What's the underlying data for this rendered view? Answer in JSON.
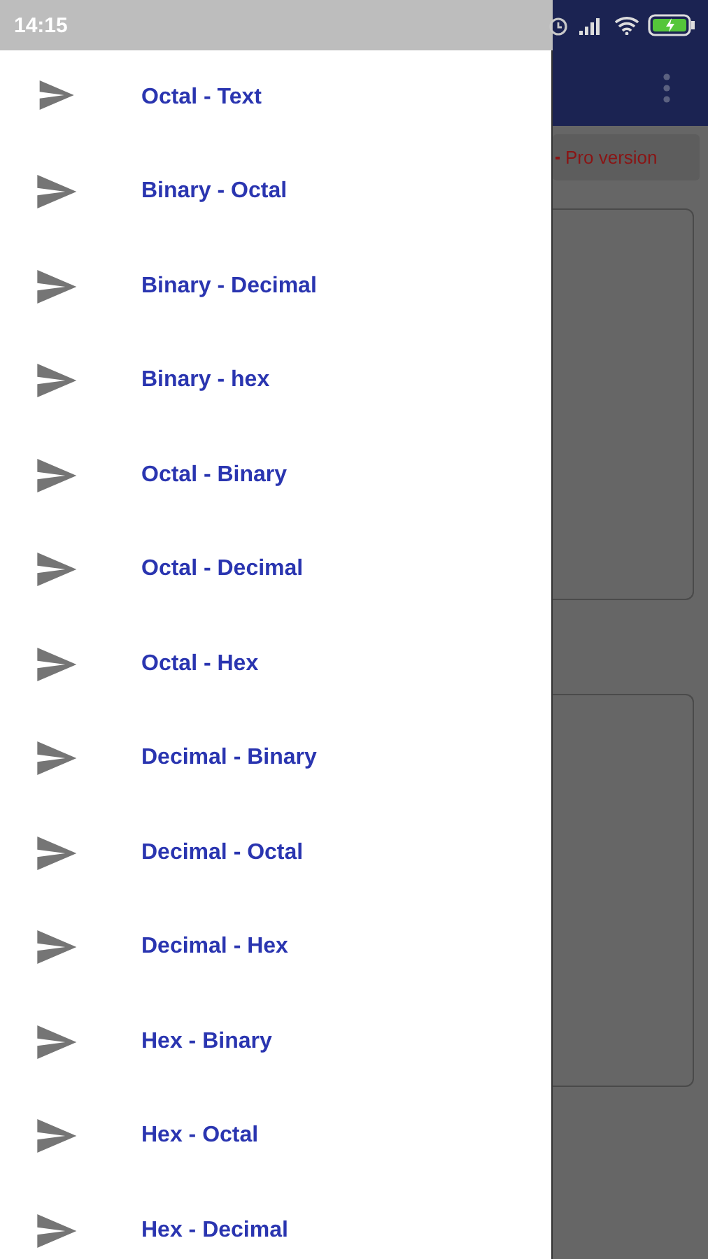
{
  "status_bar": {
    "time": "14:15"
  },
  "drawer": {
    "items": [
      {
        "label": "Octal - Text"
      },
      {
        "label": "Binary - Octal"
      },
      {
        "label": "Binary - Decimal"
      },
      {
        "label": "Binary - hex"
      },
      {
        "label": "Octal - Binary"
      },
      {
        "label": "Octal - Decimal"
      },
      {
        "label": "Octal - Hex"
      },
      {
        "label": "Decimal - Binary"
      },
      {
        "label": "Decimal - Octal"
      },
      {
        "label": "Decimal - Hex"
      },
      {
        "label": "Hex - Binary"
      },
      {
        "label": "Hex - Octal"
      },
      {
        "label": "Hex - Decimal"
      }
    ]
  },
  "background": {
    "pro_button": "Pro version"
  }
}
